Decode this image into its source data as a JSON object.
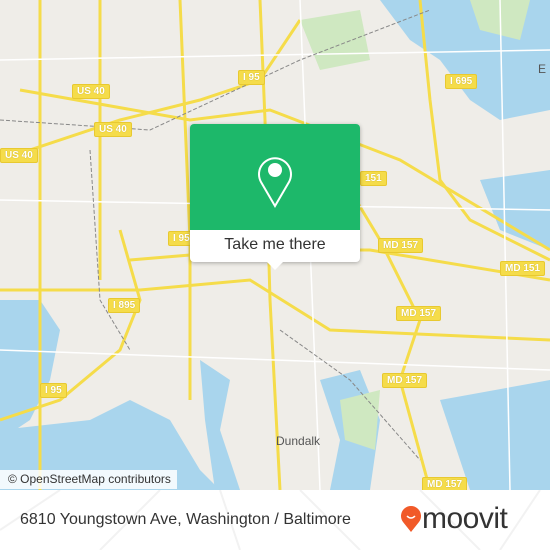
{
  "map": {
    "road_labels": [
      "I 95",
      "US 40",
      "US 40",
      "US 40",
      "I 695",
      "151",
      "I 95",
      "MD 157",
      "MD 151",
      "I 895",
      "MD 157",
      "MD 157",
      "I 95",
      "MD 157"
    ],
    "place_labels": [
      "Dundalk",
      "E"
    ],
    "attribution": "© OpenStreetMap contributors",
    "colors": {
      "water": "#a9d5ed",
      "park": "#cfe8c1",
      "road": "#f5dc4a",
      "land": "#efede8"
    }
  },
  "popup": {
    "icon": "map-pin-icon",
    "button_label": "Take me there",
    "color": "#1db86a"
  },
  "footer": {
    "address": "6810 Youngstown Ave, Washington / Baltimore",
    "brand": "moovit",
    "brand_color": "#f15a29"
  }
}
